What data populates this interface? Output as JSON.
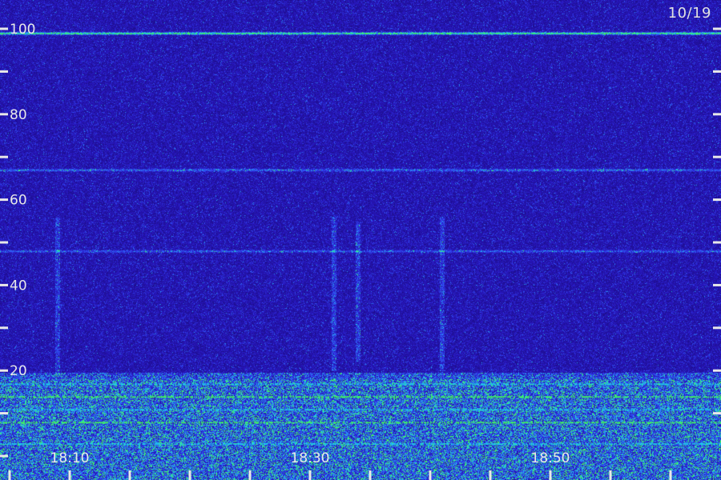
{
  "chart_data": {
    "type": "heatmap",
    "date_label": "10/19",
    "y_axis": {
      "range": [
        0,
        100
      ],
      "labeled_ticks": [
        "20",
        "40",
        "60",
        "80",
        "100"
      ],
      "minor_ticks": [
        10,
        30,
        50,
        70,
        90
      ]
    },
    "x_axis": {
      "labeled_ticks": [
        "18:10",
        "18:30",
        "18:50"
      ],
      "tick_times": [
        "18:05",
        "18:10",
        "18:15",
        "18:20",
        "18:25",
        "18:30",
        "18:35",
        "18:40",
        "18:45",
        "18:50",
        "18:55",
        "19:00"
      ]
    },
    "colors": {
      "background": "#1c0c6a",
      "noise_low": "#14086a",
      "noise_mid": "#3030d8",
      "noise_high": "#20c8e8",
      "strong": "#40f060",
      "text": "#e8e8e8"
    },
    "features": [
      {
        "kind": "horizontal-line",
        "freq": 99,
        "strength": 0.85
      },
      {
        "kind": "horizontal-line",
        "freq": 67,
        "strength": 0.45
      },
      {
        "kind": "horizontal-line",
        "freq": 48,
        "strength": 0.4
      },
      {
        "kind": "vertical-burst",
        "time": "18:09",
        "freq_range": [
          19,
          56
        ]
      },
      {
        "kind": "vertical-burst",
        "time": "18:32",
        "freq_range": [
          20,
          56
        ]
      },
      {
        "kind": "vertical-burst",
        "time": "18:34",
        "freq_range": [
          22,
          55
        ]
      },
      {
        "kind": "vertical-burst",
        "time": "18:41",
        "freq_range": [
          20,
          56
        ]
      },
      {
        "kind": "low-band",
        "freq_range": [
          0,
          18
        ],
        "strength": 0.9
      }
    ]
  }
}
